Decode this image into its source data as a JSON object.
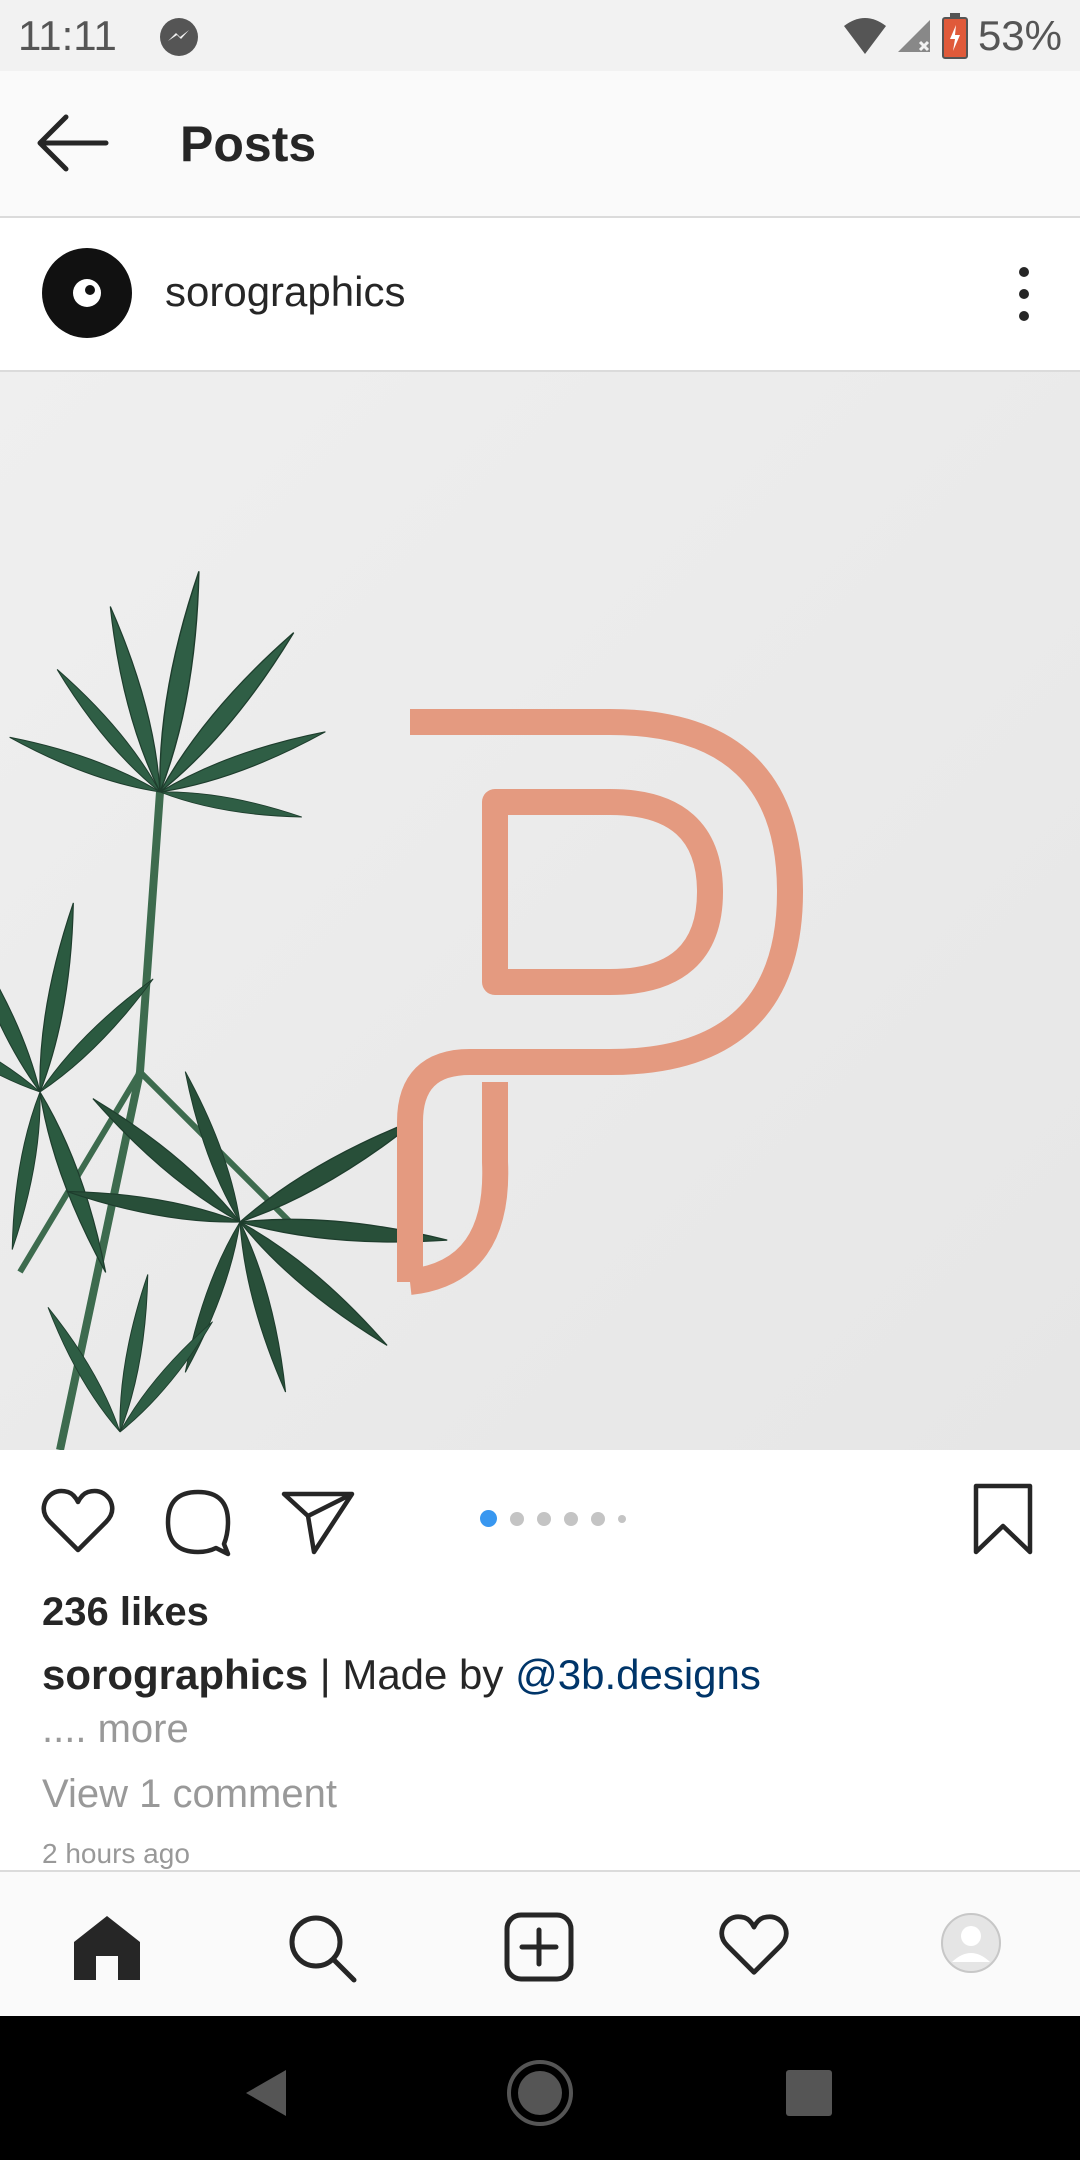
{
  "status_bar": {
    "time": "11:11",
    "battery": "53%"
  },
  "header": {
    "title": "Posts"
  },
  "post": {
    "username": "sorographics",
    "likes": "236 likes",
    "caption_user": "sorographics",
    "caption_text": " | Made by ",
    "caption_mention": "@3b.designs",
    "more": ".... more",
    "view_comments": "View 1 comment",
    "timestamp": "2 hours ago",
    "carousel": {
      "count": 6,
      "active_index": 0
    }
  },
  "colors": {
    "accent": "#3897f0",
    "mention": "#003569",
    "logo": "#e49a80"
  }
}
